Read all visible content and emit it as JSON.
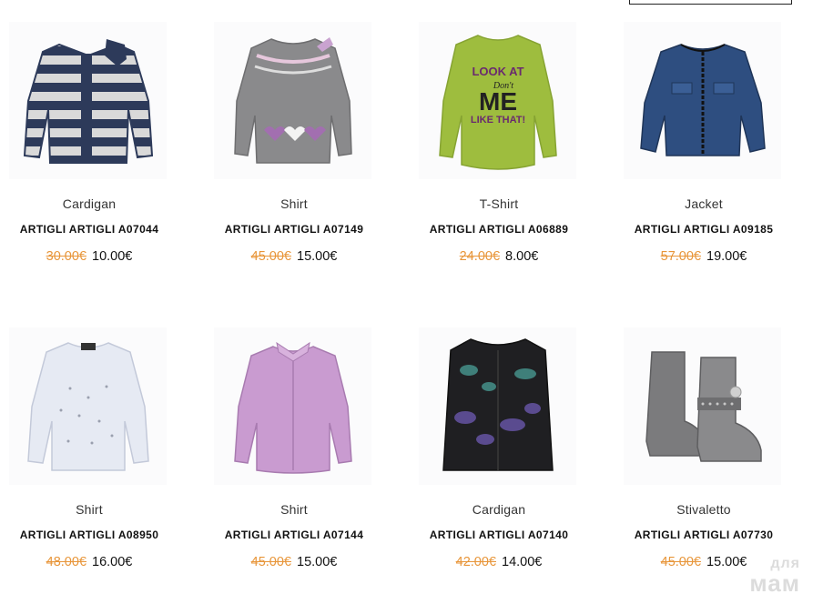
{
  "products": [
    {
      "category": "Cardigan",
      "name": "ARTIGLI ARTIGLI A07044",
      "old_price": "30.00€",
      "price": "10.00€",
      "icon": "striped-cardigan-image"
    },
    {
      "category": "Shirt",
      "name": "ARTIGLI ARTIGLI A07149",
      "old_price": "45.00€",
      "price": "15.00€",
      "icon": "grey-heart-sweater-image"
    },
    {
      "category": "T-Shirt",
      "name": "ARTIGLI ARTIGLI A06889",
      "old_price": "24.00€",
      "price": "8.00€",
      "icon": "green-look-at-me-tshirt-image",
      "print": [
        "LOOK AT",
        "Don't",
        "ME",
        "LIKE THAT!"
      ]
    },
    {
      "category": "Jacket",
      "name": "ARTIGLI ARTIGLI A09185",
      "old_price": "57.00€",
      "price": "19.00€",
      "icon": "denim-jacket-image"
    },
    {
      "category": "Shirt",
      "name": "ARTIGLI ARTIGLI A08950",
      "old_price": "48.00€",
      "price": "16.00€",
      "icon": "white-sweater-image"
    },
    {
      "category": "Shirt",
      "name": "ARTIGLI ARTIGLI A07144",
      "old_price": "45.00€",
      "price": "15.00€",
      "icon": "pink-blouse-image"
    },
    {
      "category": "Cardigan",
      "name": "ARTIGLI ARTIGLI A07140",
      "old_price": "42.00€",
      "price": "14.00€",
      "icon": "dark-pattern-cardigan-image"
    },
    {
      "category": "Stivaletto",
      "name": "ARTIGLI ARTIGLI A07730",
      "old_price": "45.00€",
      "price": "15.00€",
      "icon": "grey-boots-image"
    }
  ],
  "watermark": {
    "line1": "для",
    "line2": "мам"
  },
  "colors": {
    "old_price": "#e8963a",
    "text": "#111111"
  }
}
